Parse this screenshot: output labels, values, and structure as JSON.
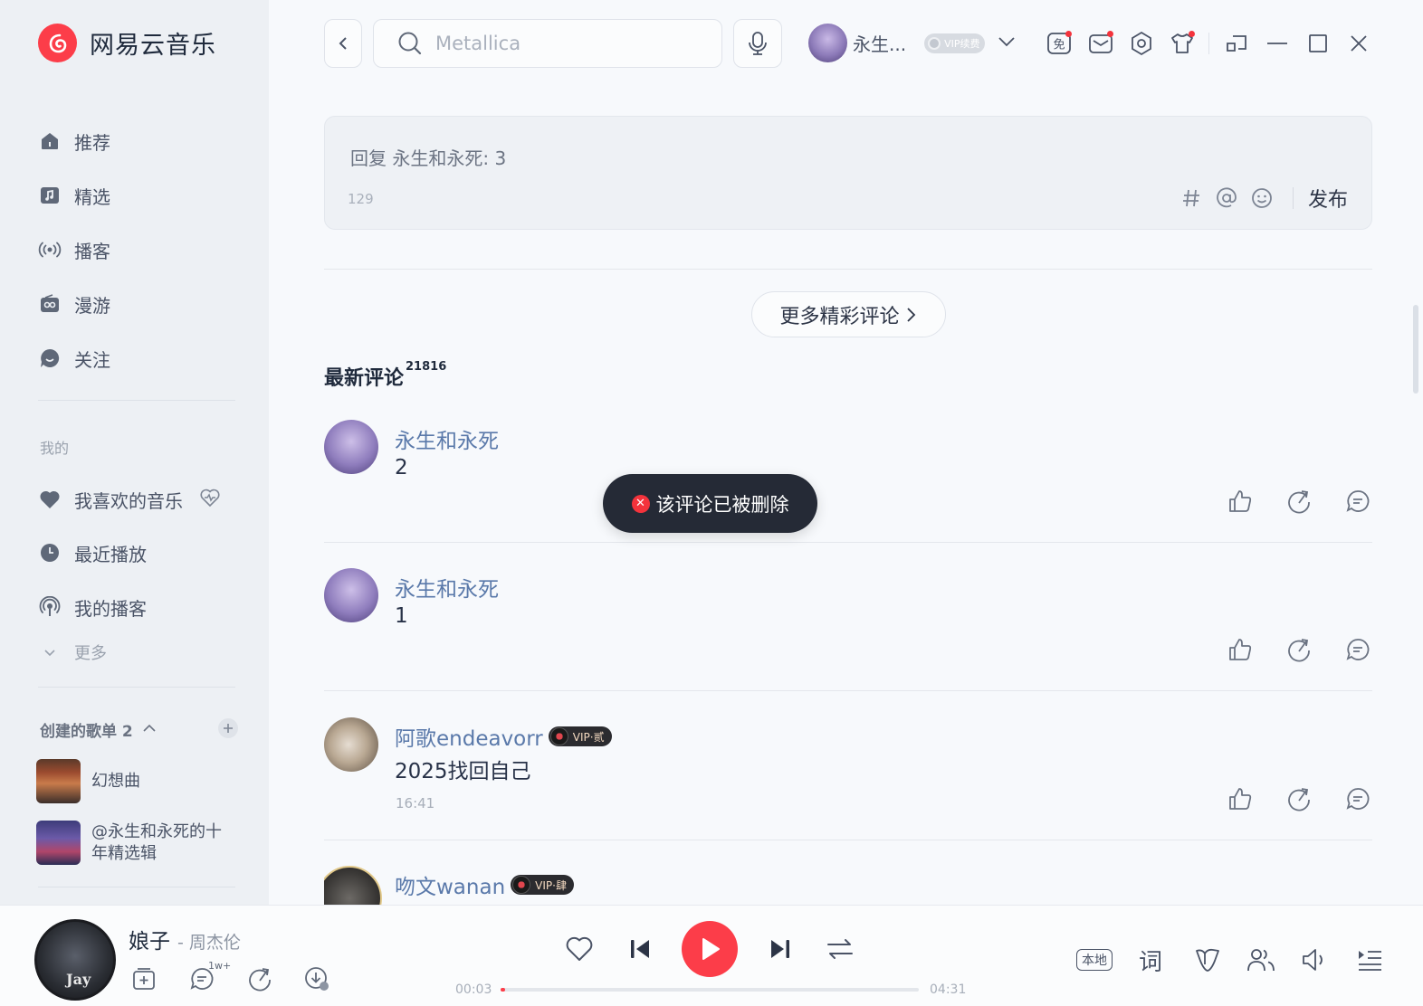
{
  "app": {
    "name": "网易云音乐"
  },
  "sidebar": {
    "nav": [
      {
        "label": "推荐",
        "icon": "home-icon"
      },
      {
        "label": "精选",
        "icon": "music-note-icon"
      },
      {
        "label": "播客",
        "icon": "broadcast-icon"
      },
      {
        "label": "漫游",
        "icon": "radio-icon"
      },
      {
        "label": "关注",
        "icon": "chat-bubble-icon"
      }
    ],
    "mine_title": "我的",
    "mine": [
      {
        "label": "我喜欢的音乐",
        "icon": "heart-icon"
      },
      {
        "label": "最近播放",
        "icon": "clock-icon"
      },
      {
        "label": "我的播客",
        "icon": "podcast-icon"
      }
    ],
    "more_label": "更多",
    "created_title": "创建的歌单 2",
    "playlists": [
      {
        "title": "幻想曲"
      },
      {
        "title": "@永生和永死的十年精选辑"
      }
    ]
  },
  "topbar": {
    "search_placeholder": "Metallica",
    "username": "永生...",
    "vip_label": "VIP续费"
  },
  "reply": {
    "text": "回复 永生和永死: 3",
    "count": "129",
    "publish_label": "发布"
  },
  "more_comments_label": "更多精彩评论",
  "latest": {
    "title": "最新评论",
    "count": "21816"
  },
  "comments": [
    {
      "user": "永生和永死",
      "text": "2",
      "time": ""
    },
    {
      "user": "永生和永死",
      "text": "1",
      "time": ""
    },
    {
      "user": "阿歌endeavorr",
      "vip": "VIP·贰",
      "text": "2025找回自己",
      "time": "16:41"
    },
    {
      "user": "吻文wanan",
      "vip": "VIP·肆",
      "text": "",
      "time": ""
    }
  ],
  "toast": "该评论已被删除",
  "player": {
    "title": "娘子",
    "artist": "- 周杰伦",
    "cover_text": "Jay",
    "comment_badge": "1w+",
    "current_time": "00:03",
    "total_time": "04:31",
    "progress": 0.011,
    "local_label": "本地",
    "lyrics_label": "词"
  },
  "colors": {
    "accent": "#fc3d49",
    "link": "#5a79aa"
  }
}
